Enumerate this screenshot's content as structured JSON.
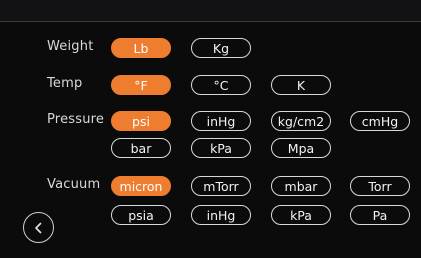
{
  "rows": {
    "weight": {
      "label": "Weight",
      "options": [
        "Lb",
        "Kg"
      ],
      "selected": "Lb"
    },
    "temp": {
      "label": "Temp",
      "options": [
        "°F",
        "°C",
        "K"
      ],
      "selected": "°F"
    },
    "pressure": {
      "label": "Pressure",
      "options": [
        "psi",
        "inHg",
        "kg/cm2",
        "cmHg",
        "bar",
        "kPa",
        "Mpa"
      ],
      "selected": "psi"
    },
    "vacuum": {
      "label": "Vacuum",
      "options": [
        "micron",
        "mTorr",
        "mbar",
        "Torr",
        "psia",
        "inHg",
        "kPa",
        "Pa"
      ],
      "selected": "micron"
    }
  },
  "icons": {
    "back": "chevron-left-icon"
  },
  "colors": {
    "accent": "#ef7d2f",
    "background": "#0b0b0c"
  }
}
